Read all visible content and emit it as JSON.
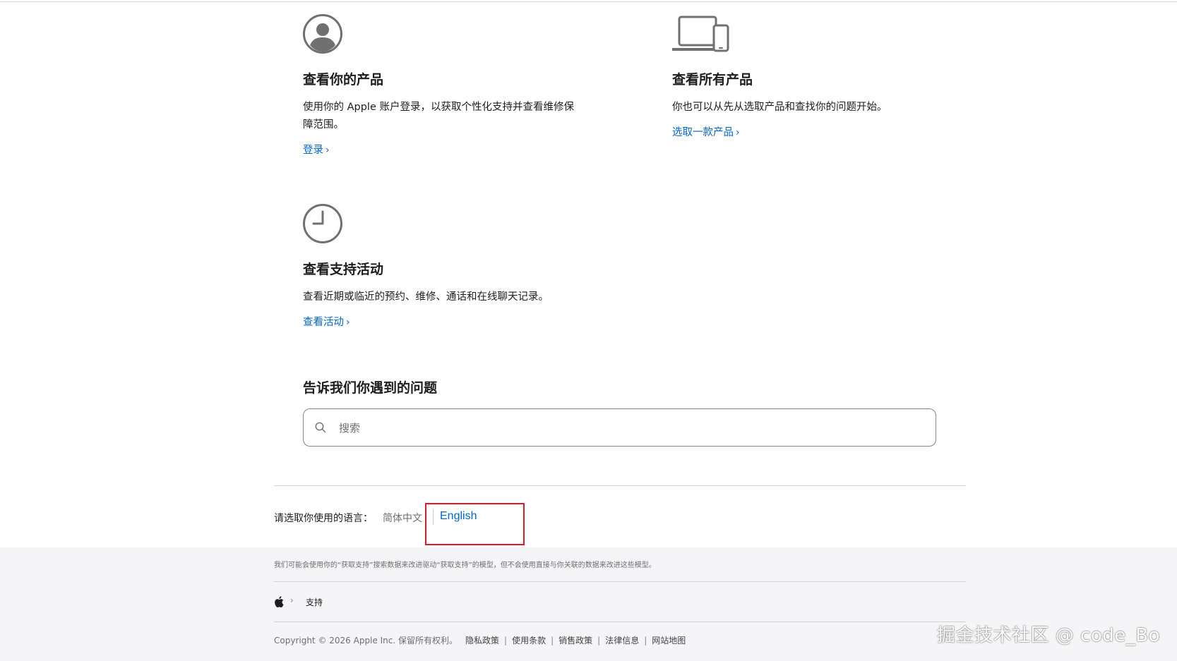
{
  "cards": {
    "your_products": {
      "title": "查看你的产品",
      "description": "使用你的 Apple 账户登录，以获取个性化支持并查看维修保障范围。",
      "link": "登录",
      "icon": "person-circle-icon"
    },
    "all_products": {
      "title": "查看所有产品",
      "description": "你也可以从先从选取产品和查找你的问题开始。",
      "link": "选取一款产品",
      "icon": "laptop-phone-icon"
    },
    "activity": {
      "title": "查看支持活动",
      "description": "查看近期或临近的预约、维修、通话和在线聊天记录。",
      "link": "查看活动",
      "icon": "clock-icon"
    }
  },
  "link_chevron": "›",
  "search": {
    "heading": "告诉我们你遇到的问题",
    "placeholder": "搜索",
    "value": ""
  },
  "language": {
    "label": "请选取你使用的语言：",
    "options": [
      "简体中文",
      "English"
    ],
    "selected": "简体中文"
  },
  "footer": {
    "disclaimer": "我们可能会使用你的“获取支持”搜索数据来改进驱动“获取支持”的模型，但不会使用直接与你关联的数据来改进这些模型。",
    "breadcrumb": {
      "separator": "›",
      "current": "支持"
    },
    "copyright": "Copyright © 2026 Apple Inc. 保留所有权利。",
    "links": [
      "隐私政策",
      "使用条款",
      "销售政策",
      "法律信息",
      "网站地图"
    ],
    "link_separator": "|"
  },
  "watermark": "掘金技术社区 @ code_Bo",
  "colors": {
    "link": "#0066cc",
    "highlight": "#e2192c",
    "footer_bg": "#f5f5f7",
    "icon": "#707070"
  }
}
